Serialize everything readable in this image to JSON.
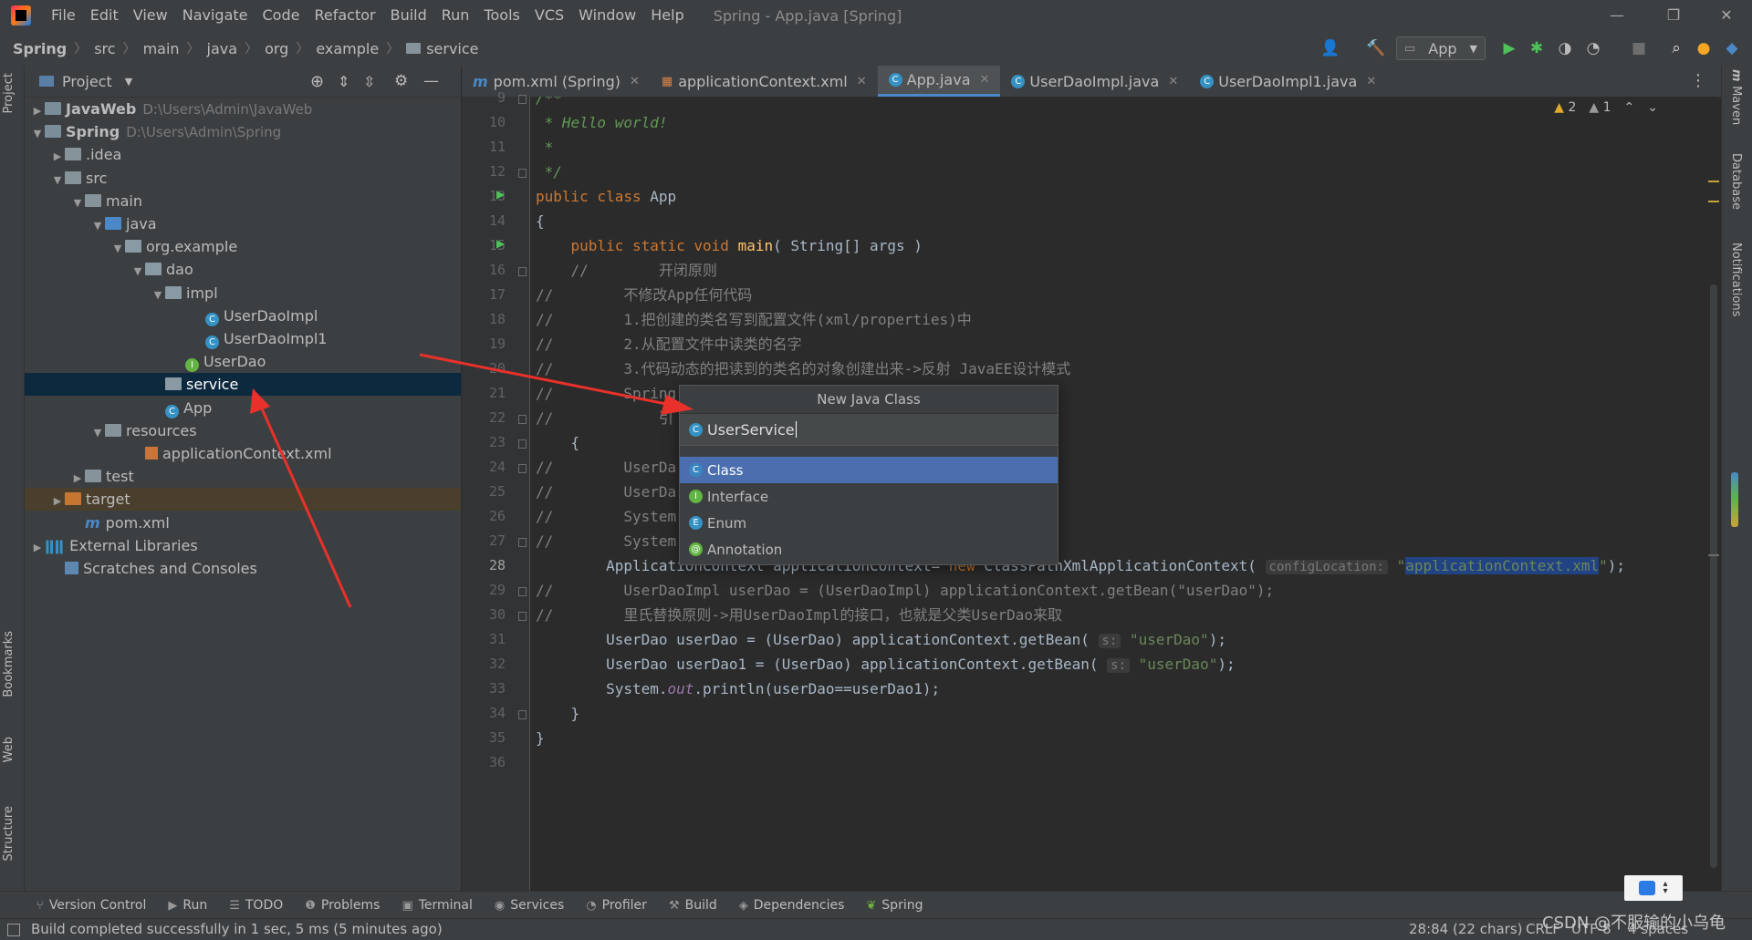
{
  "window": {
    "title": "Spring - App.java [Spring]"
  },
  "menu": [
    "File",
    "Edit",
    "View",
    "Navigate",
    "Code",
    "Refactor",
    "Build",
    "Run",
    "Tools",
    "VCS",
    "Window",
    "Help"
  ],
  "breadcrumb": [
    "Spring",
    "src",
    "main",
    "java",
    "org",
    "example",
    "service"
  ],
  "toolbar": {
    "run_config": "App"
  },
  "project_panel": {
    "title": "Project",
    "tree": [
      {
        "label": "JavaWeb",
        "hint": "D:\\Users\\Admin\\JavaWeb",
        "depth": 0,
        "arrow": "›",
        "icon": "module",
        "bold": true
      },
      {
        "label": "Spring",
        "hint": "D:\\Users\\Admin\\Spring",
        "depth": 0,
        "arrow": "⌄",
        "icon": "module",
        "bold": true
      },
      {
        "label": ".idea",
        "depth": 1,
        "arrow": "›",
        "icon": "folder"
      },
      {
        "label": "src",
        "depth": 1,
        "arrow": "⌄",
        "icon": "folder"
      },
      {
        "label": "main",
        "depth": 2,
        "arrow": "⌄",
        "icon": "folder"
      },
      {
        "label": "java",
        "depth": 3,
        "arrow": "⌄",
        "icon": "folder-blue"
      },
      {
        "label": "org.example",
        "depth": 4,
        "arrow": "⌄",
        "icon": "package"
      },
      {
        "label": "dao",
        "depth": 5,
        "arrow": "⌄",
        "icon": "package"
      },
      {
        "label": "impl",
        "depth": 6,
        "arrow": "⌄",
        "icon": "package"
      },
      {
        "label": "UserDaoImpl",
        "depth": 8,
        "arrow": "",
        "icon": "class"
      },
      {
        "label": "UserDaoImpl1",
        "depth": 8,
        "arrow": "",
        "icon": "class"
      },
      {
        "label": "UserDao",
        "depth": 7,
        "arrow": "",
        "icon": "interface"
      },
      {
        "label": "service",
        "depth": 6,
        "arrow": "",
        "icon": "package",
        "selected": true
      },
      {
        "label": "App",
        "depth": 6,
        "arrow": "",
        "icon": "class"
      },
      {
        "label": "resources",
        "depth": 3,
        "arrow": "⌄",
        "icon": "folder"
      },
      {
        "label": "applicationContext.xml",
        "depth": 5,
        "arrow": "",
        "icon": "xml"
      },
      {
        "label": "test",
        "depth": 2,
        "arrow": "›",
        "icon": "folder"
      },
      {
        "label": "target",
        "depth": 1,
        "arrow": "›",
        "icon": "folder-orange",
        "excluded": true
      },
      {
        "label": "pom.xml",
        "depth": 2,
        "arrow": "",
        "icon": "maven"
      },
      {
        "label": "External Libraries",
        "depth": 0,
        "arrow": "›",
        "icon": "libs"
      },
      {
        "label": "Scratches and Consoles",
        "depth": 1,
        "arrow": "",
        "icon": "scratch"
      }
    ]
  },
  "tabs": [
    {
      "label": "pom.xml (Spring)",
      "icon": "m"
    },
    {
      "label": "applicationContext.xml",
      "icon": "xml"
    },
    {
      "label": "App.java",
      "icon": "c",
      "active": true
    },
    {
      "label": "UserDaoImpl.java",
      "icon": "c"
    },
    {
      "label": "UserDaoImpl1.java",
      "icon": "c"
    }
  ],
  "inspections": {
    "warnings": "2",
    "weak": "1"
  },
  "editor": {
    "line_numbers": [
      "9",
      "10",
      "11",
      "12",
      "13",
      "14",
      "15",
      "16",
      "17",
      "18",
      "19",
      "20",
      "21",
      "22",
      "23",
      "24",
      "25",
      "26",
      "27",
      "28",
      "29",
      "30",
      "31",
      "32",
      "33",
      "34",
      "35",
      "36"
    ],
    "current_line": "28"
  },
  "code": {
    "l9": "/**",
    "l10": " * Hello world!",
    "l11": " *",
    "l12": " */",
    "l13_kw": "public class ",
    "l13_name": "App",
    "l14": "{",
    "l15_kw": "    public static void ",
    "l15_fn": "main",
    "l15_rest": "( String[] args )",
    "l16": "    //        开闭原则",
    "l17": "//        不修改App任何代码",
    "l18": "//        1.把创建的类名写到配置文件(xml/properties)中",
    "l19": "//        2.从配置文件中读类的名字",
    "l20": "//        3.代码动态的把读到的类名的对象创建出来->反射 JavaEE设计模式",
    "l21": "//        Spring",
    "l22": "//            引",
    "l23": "    {",
    "l24": "//        UserDa",
    "l25": "//        UserDa",
    "l26": "//        System",
    "l27": "//        System",
    "l28_a": "        ApplicationContext applicationContext= ",
    "l28_new": "new ",
    "l28_b": "ClassPathXmlApplicationContext( ",
    "l28_hint": "configLocation:",
    "l28_q1": " \"",
    "l28_sel": "applicationContext.xml",
    "l28_q2": "\"",
    "l28_end": ");",
    "l29": "//        UserDaoImpl userDao = (UserDaoImpl) applicationContext.getBean(\"userDao\");",
    "l30": "//        里氏替换原则->用UserDaoImpl的接口，也就是父类UserDao来取",
    "l31_a": "        UserDao userDao = (UserDao) applicationContext.getBean( ",
    "l31_hint": "s:",
    "l31_str": " \"userDao\"",
    "l31_end": ");",
    "l32_a": "        UserDao userDao1 = (UserDao) applicationContext.getBean( ",
    "l32_hint": "s:",
    "l32_str": " \"userDao\"",
    "l32_end": ");",
    "l33_a": "        System.",
    "l33_out": "out",
    "l33_b": ".println(userDao==userDao1);",
    "l34": "    }",
    "l35": "}",
    "l36": ""
  },
  "popup": {
    "title": "New Java Class",
    "input_value": "UserService",
    "items": [
      "Class",
      "Interface",
      "Enum",
      "Annotation"
    ],
    "selected": "Class"
  },
  "right_strip": [
    "Maven",
    "Database",
    "Notifications"
  ],
  "left_strip": [
    "Project",
    "Bookmarks",
    "Web",
    "Structure"
  ],
  "bottom_tools": [
    "Version Control",
    "Run",
    "TODO",
    "Problems",
    "Terminal",
    "Services",
    "Profiler",
    "Build",
    "Dependencies",
    "Spring"
  ],
  "status": {
    "message": "Build completed successfully in 1 sec, 5 ms (5 minutes ago)",
    "position": "28:84 (22 chars)",
    "line_sep": "CRLF",
    "encoding": "UTF-8",
    "indent": "4 spaces"
  },
  "watermark": "CSDN @不服输的小乌龟",
  "colors": {
    "accent": "#4a88c7",
    "selection": "#4b6eaf",
    "annotation_arrow": "#e8312a"
  }
}
